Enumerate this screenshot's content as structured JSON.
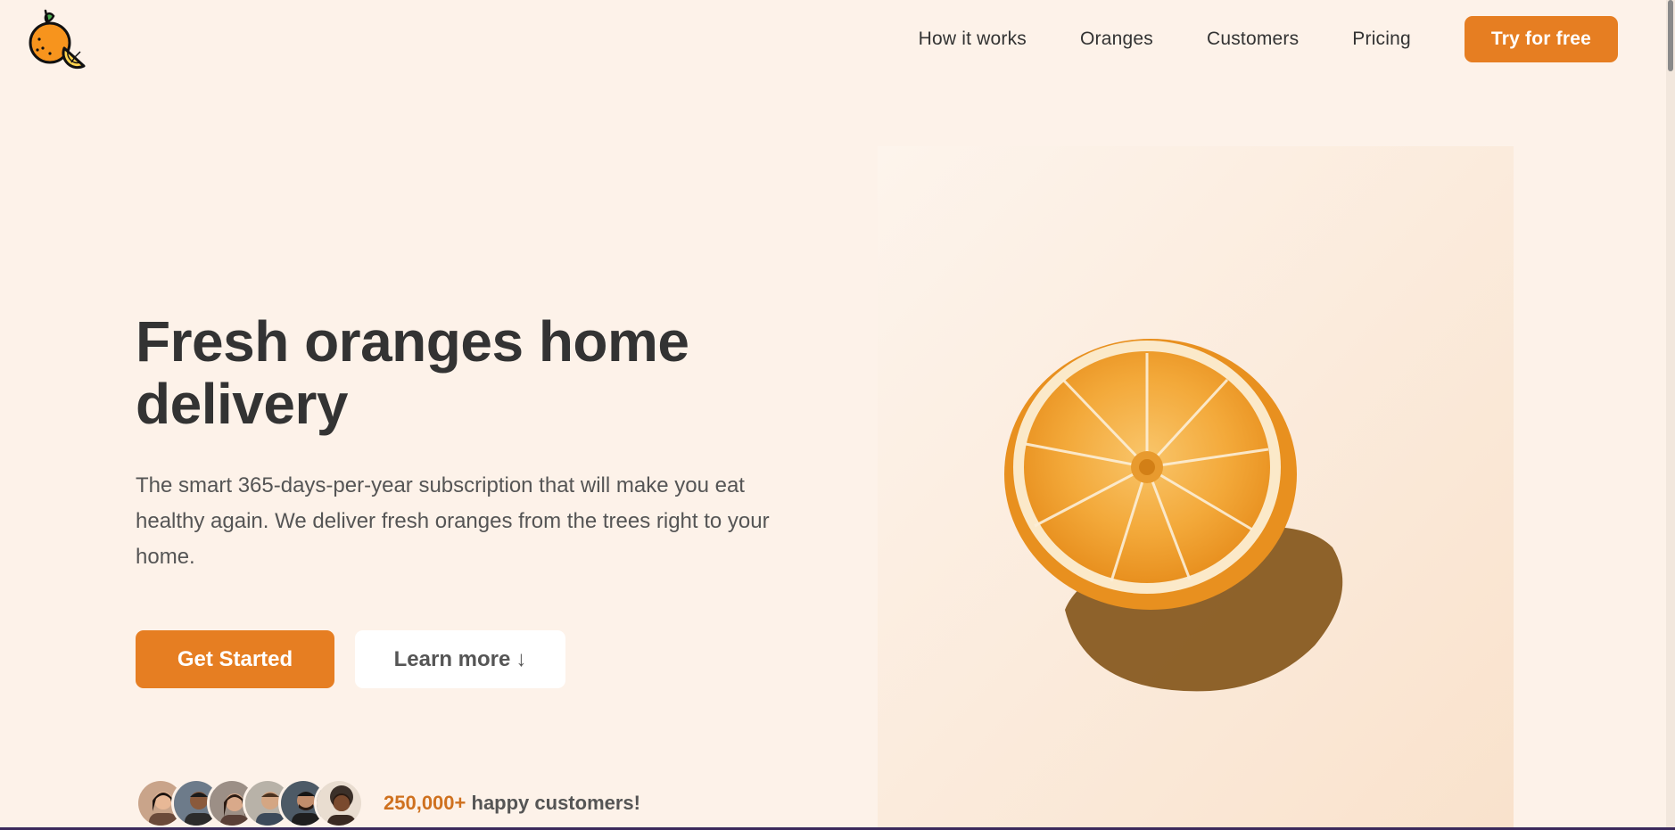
{
  "header": {
    "nav": [
      {
        "label": "How it works"
      },
      {
        "label": "Oranges"
      },
      {
        "label": "Customers"
      },
      {
        "label": "Pricing"
      }
    ],
    "cta_label": "Try for free"
  },
  "hero": {
    "title": "Fresh oranges home delivery",
    "description": "The smart 365-days-per-year subscription that will make you eat healthy again. We deliver fresh oranges from the trees right to your home.",
    "primary_button": "Get Started",
    "secondary_button": "Learn more",
    "secondary_button_arrow": "↓",
    "customers_count": "250,000+",
    "customers_text": "happy customers!"
  },
  "colors": {
    "background": "#fdf2e9",
    "accent": "#e67e22",
    "accent_dark": "#cf711f",
    "text": "#333333"
  },
  "icons": {
    "logo": "orange-fruit-logo-icon",
    "scroll_arrow": "down-arrow-icon"
  }
}
